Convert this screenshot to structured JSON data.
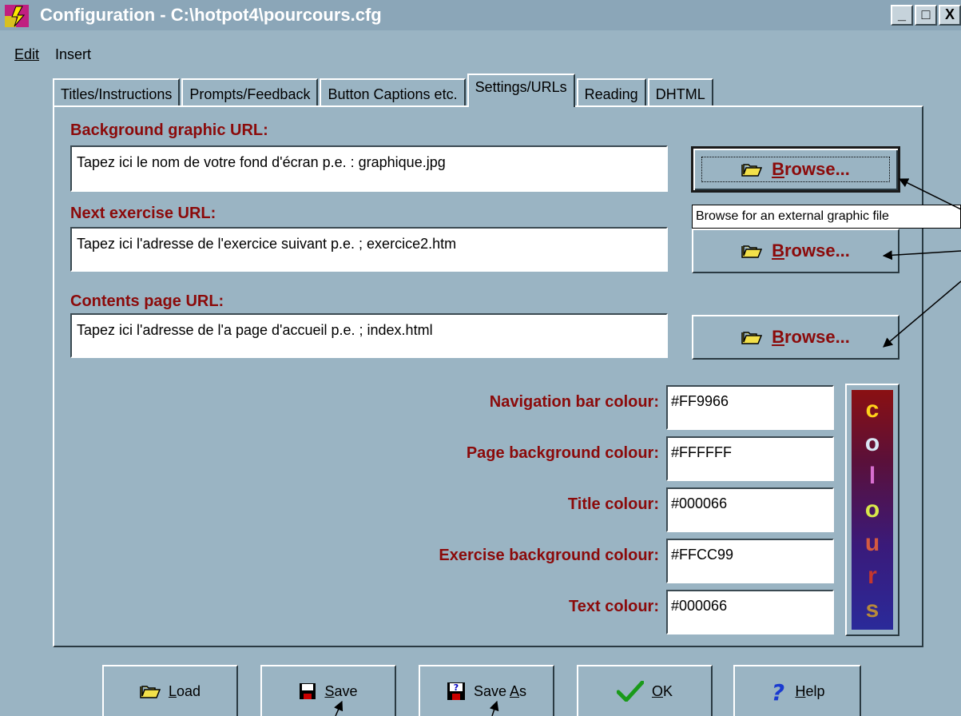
{
  "window": {
    "title": "Configuration - C:\\hotpot4\\pourcours.cfg",
    "minimize": "_",
    "maximize": "□",
    "close": "X"
  },
  "menu": {
    "items": [
      {
        "label": "Edit"
      },
      {
        "label": "Insert"
      }
    ]
  },
  "tabs": [
    {
      "label": "Titles/Instructions",
      "active": false
    },
    {
      "label": "Prompts/Feedback",
      "active": false
    },
    {
      "label": "Button Captions etc.",
      "active": false
    },
    {
      "label": "Settings/URLs",
      "active": true
    },
    {
      "label": "Reading",
      "active": false
    },
    {
      "label": "DHTML",
      "active": false
    }
  ],
  "urls": {
    "background": {
      "label": "Background graphic URL:",
      "value": "Tapez ici le nom de votre fond d'écran p.e. : graphique.jpg"
    },
    "next": {
      "label": "Next exercise URL:",
      "value": "Tapez ici l'adresse de l'exercice suivant p.e. ; exercice2.htm"
    },
    "contents": {
      "label": "Contents page URL:",
      "value": "Tapez ici l'adresse de l'a page d'accueil p.e. ; index.html"
    },
    "browse_label": "Browse...",
    "browse_hotkey": "B",
    "browse_rest": "rowse..."
  },
  "tooltip": "Browse for an external graphic file",
  "colours": {
    "nav_bar": {
      "label": "Navigation bar colour:",
      "value": "#FF9966"
    },
    "page_bg": {
      "label": "Page background colour:",
      "value": "#FFFFFF"
    },
    "title": {
      "label": "Title colour:",
      "value": "#000066"
    },
    "exercise_bg": {
      "label": "Exercise background colour:",
      "value": "#FFCC99"
    },
    "text": {
      "label": "Text colour:",
      "value": "#000066"
    },
    "button_letters": [
      "c",
      "o",
      "l",
      "o",
      "u",
      "r",
      "s"
    ],
    "button_letter_colors": [
      "#ffd21a",
      "#d9e8f5",
      "#d86fd0",
      "#d8e84a",
      "#d45a40",
      "#c4372d",
      "#b88a3a"
    ]
  },
  "buttons": {
    "load": {
      "hotkey": "L",
      "rest": "oad"
    },
    "save": {
      "hotkey": "S",
      "rest": "ave"
    },
    "save_as": {
      "pre": "Save ",
      "hotkey": "A",
      "rest": "s"
    },
    "ok": {
      "hotkey": "O",
      "rest": "K"
    },
    "help": {
      "hotkey": "H",
      "rest": "elp"
    }
  },
  "accent_colors": {
    "label_red": "#8b0a0a",
    "background": "#9ab4c3"
  }
}
